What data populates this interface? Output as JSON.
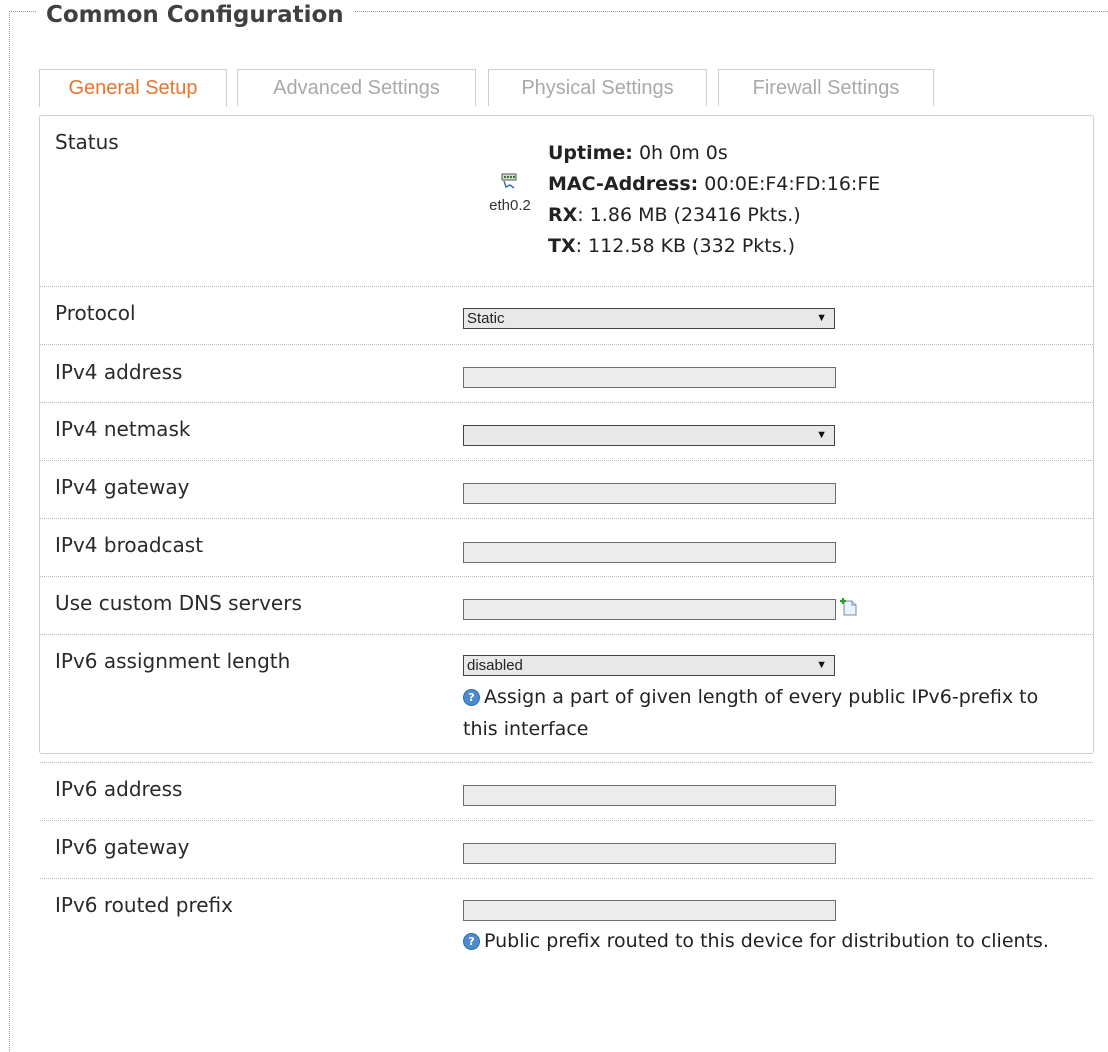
{
  "section": {
    "title": "Common Configuration"
  },
  "tabs": [
    {
      "label": "General Setup",
      "active": true
    },
    {
      "label": "Advanced Settings",
      "active": false
    },
    {
      "label": "Physical Settings",
      "active": false
    },
    {
      "label": "Firewall Settings",
      "active": false
    }
  ],
  "status": {
    "label": "Status",
    "interface_name": "eth0.2",
    "interface_icon": "ethernet-port-icon",
    "uptime_label": "Uptime:",
    "uptime_value": " 0h 0m 0s",
    "mac_label": "MAC-Address:",
    "mac_value": " 00:0E:F4:FD:16:FE",
    "rx_label": "RX",
    "rx_value": ": 1.86 MB (23416 Pkts.)",
    "tx_label": "TX",
    "tx_value": ": 112.58 KB (332 Pkts.)"
  },
  "fields": {
    "protocol": {
      "label": "Protocol",
      "value": "Static"
    },
    "ipv4_address": {
      "label": "IPv4 address",
      "value": ""
    },
    "ipv4_netmask": {
      "label": "IPv4 netmask",
      "value": ""
    },
    "ipv4_gateway": {
      "label": "IPv4 gateway",
      "value": ""
    },
    "ipv4_broadcast": {
      "label": "IPv4 broadcast",
      "value": ""
    },
    "dns": {
      "label": "Use custom DNS servers",
      "value": "",
      "add_icon": "add-entry-icon"
    },
    "ipv6_assign": {
      "label": "IPv6 assignment length",
      "value": "disabled",
      "hint": "Assign a part of given length of every public IPv6-prefix to this interface"
    },
    "ipv6_address": {
      "label": "IPv6 address",
      "value": ""
    },
    "ipv6_gateway": {
      "label": "IPv6 gateway",
      "value": ""
    },
    "ipv6_prefix": {
      "label": "IPv6 routed prefix",
      "value": "",
      "hint": "Public prefix routed to this device for distribution to clients."
    }
  },
  "colors": {
    "active_tab": "#e8742e",
    "inactive_tab": "#a9a9a9",
    "help_icon": "#4d8ccc"
  }
}
